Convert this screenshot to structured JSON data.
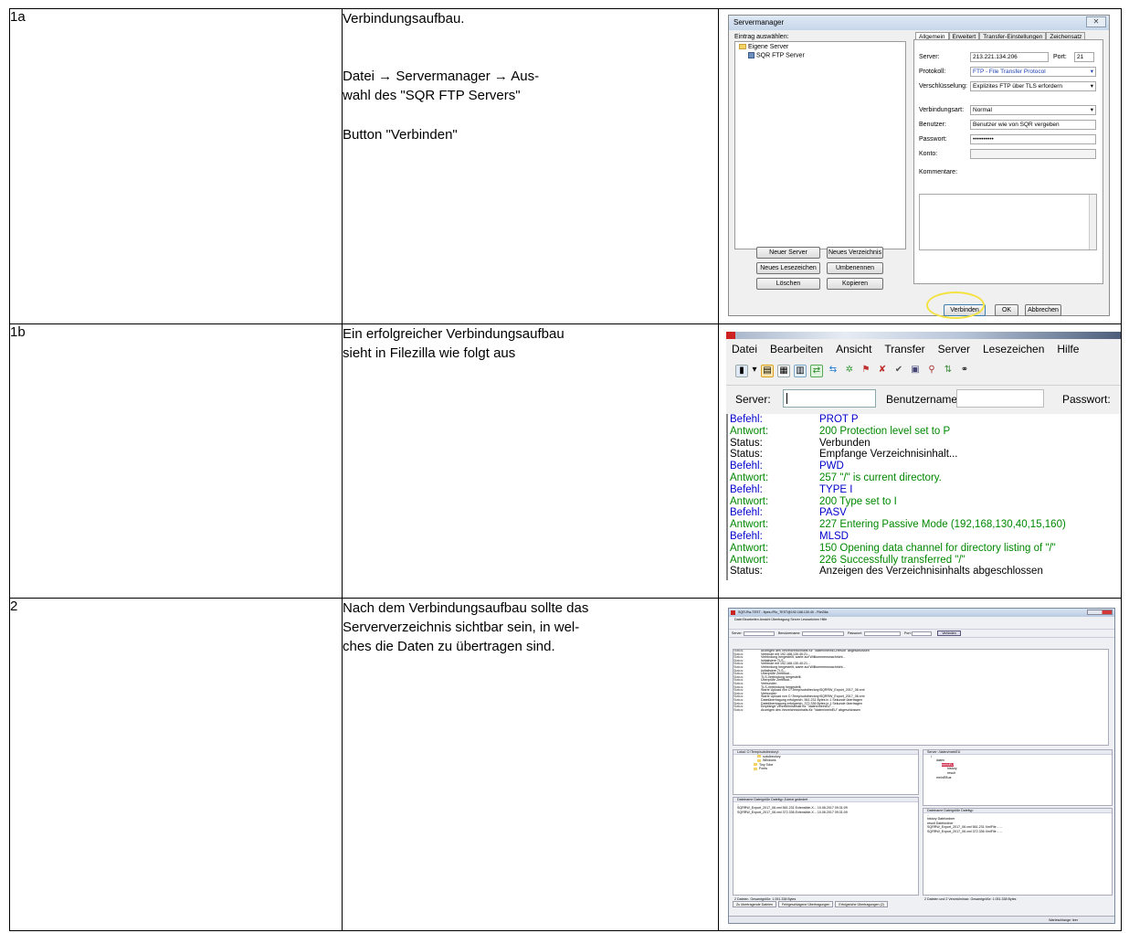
{
  "rows": [
    {
      "step": "1a",
      "lines": [
        "Verbindungsaufbau.",
        "Datei → Servermanager → Aus-",
        "wahl des \"SQR FTP Servers\"",
        "Button \"Verbinden\""
      ]
    },
    {
      "step": "1b",
      "lines": [
        "Ein erfolgreicher Verbindungsaufbau",
        "sieht in Filezilla wie folgt aus"
      ]
    },
    {
      "step": "2",
      "lines": [
        "Nach dem Verbindungsaufbau sollte das",
        "Serververzeichnis sichtbar sein, in wel-",
        "ches die Daten zu übertragen sind."
      ]
    }
  ],
  "servermanager": {
    "title": "Servermanager",
    "close": "✕",
    "eintrag_label": "Eintrag auswählen:",
    "tree": [
      "Eigene Server",
      "SQR FTP Server"
    ],
    "tabs": [
      "Allgemein",
      "Erweitert",
      "Transfer-Einstellungen",
      "Zeichensatz"
    ],
    "fields": [
      {
        "label": "Server:",
        "value": "213.221.134.206"
      },
      {
        "label": "Protokoll:",
        "value": "FTP - File Transfer Protocol"
      },
      {
        "label": "Verschlüsselung:",
        "value": "Explizites FTP über TLS erfordern"
      },
      {
        "label": "Verbindungsart:",
        "value": "Normal"
      },
      {
        "label": "Benutzer:",
        "value": "Benutzer wie von SQR vergeben"
      },
      {
        "label": "Passwort:",
        "value": "••••••••••"
      },
      {
        "label": "Konto:",
        "value": ""
      }
    ],
    "port_label": "Port:",
    "port_value": "21",
    "kommentare_label": "Kommentare:",
    "buttons": [
      "Neuer Server",
      "Neues Verzeichnis",
      "Neues Lesezeichen",
      "Umbenennen",
      "Löschen",
      "Kopieren"
    ],
    "footer_buttons": [
      "Verbinden",
      "OK",
      "Abbrechen"
    ]
  },
  "filezilla": {
    "menu": [
      "Datei",
      "Bearbeiten",
      "Ansicht",
      "Transfer",
      "Server",
      "Lesezeichen",
      "Hilfe"
    ],
    "server_label": "Server:",
    "user_label": "Benutzername:",
    "pass_label": "Passwort:",
    "log": [
      {
        "k": "Befehl:",
        "v": "PROT P",
        "t": "cmd"
      },
      {
        "k": "Antwort:",
        "v": "200 Protection level set to P",
        "t": "rsp"
      },
      {
        "k": "Status:",
        "v": "Verbunden",
        "t": "sts"
      },
      {
        "k": "Status:",
        "v": "Empfange Verzeichnisinhalt...",
        "t": "sts"
      },
      {
        "k": "Befehl:",
        "v": "PWD",
        "t": "cmd"
      },
      {
        "k": "Antwort:",
        "v": "257 \"/\" is current directory.",
        "t": "rsp"
      },
      {
        "k": "Befehl:",
        "v": "TYPE I",
        "t": "cmd"
      },
      {
        "k": "Antwort:",
        "v": "200 Type set to I",
        "t": "rsp"
      },
      {
        "k": "Befehl:",
        "v": "PASV",
        "t": "cmd"
      },
      {
        "k": "Antwort:",
        "v": "227 Entering Passive Mode (192,168,130,40,15,160)",
        "t": "rsp"
      },
      {
        "k": "Befehl:",
        "v": "MLSD",
        "t": "cmd"
      },
      {
        "k": "Antwort:",
        "v": "150 Opening data channel for directory listing of \"/\"",
        "t": "rsp"
      },
      {
        "k": "Antwort:",
        "v": "226 Successfully transferred \"/\"",
        "t": "rsp"
      },
      {
        "k": "Status:",
        "v": "Anzeigen des Verzeichnisinhalts abgeschlossen",
        "t": "sts"
      }
    ]
  },
  "fz_window": {
    "title": "SQR-Rw-TEST - ftpes://Ro_TEST@192.168.130.40 - FileZilla",
    "menu": "Datei  Bearbeiten  Ansicht  Übertragung  Server  Lesezeichen  Hilfe",
    "server_label": "Server:",
    "user_label": "Benutzername:",
    "pass_label": "Passwort:",
    "port_label": "Port:",
    "connect": "Verbinden",
    "log": [
      "Anzeigen des Verzeichnisinhalts für \"/daten/meinEU/result\" abgeschlossen",
      "Verbinde mit 192.168.130.40:21...",
      "Verbindung hergestellt, warte auf Willkommensnachricht...",
      "Initialisiere TLS...",
      "Verbinde mit 192.168.130.40:21...",
      "Verbindung hergestellt, warte auf Willkommensnachricht...",
      "Initialisiere TLS...",
      "Überprüfe Zertifikat...",
      "TLS-Verbindung hergestellt.",
      "Überprüfe Zertifikat...",
      "Verbunden",
      "TLS-Verbindung hergestellt.",
      "Starte Upload von C:\\Temp\\subdirectory\\SQRRW_Export_2017_06.xml",
      "Verbunden",
      "Starte Upload von C:\\Temp\\subdirectory\\SQRRW_Export_2017_06.xml",
      "Dateiübertragung erfolgreich, 561.231 Bytes in 1 Sekunde übertragen",
      "Dateiübertragung erfolgreich, 372.336 Bytes in 1 Sekunde übertragen",
      "Empfange Verzeichnisinhalt für \"/daten/meinEU\"...",
      "Anzeigen des Verzeichnisinhalts für \"/daten/meinEU\" abgeschlossen"
    ],
    "local_label": "Lokal:",
    "local_path": "C:\\Temp\\subdirectory\\",
    "local_tree": [
      "subdirectory",
      "Windows",
      "Tiny Tobe",
      "Fonts"
    ],
    "local_cols": "Dateiname                      Dateigröße  Dateityp           Zuletzt geändert",
    "local_files": [
      "SQRRW_Export_2017_06.xml     561.231  Extensible-X...   10.06.2017 09:31:09",
      "SQRRW_Export_2017_06.xml     372.336  Extensible-X...   10.06.2017 09:31:09"
    ],
    "local_status": "2 Dateien. Gesamtgröße: 1.051.338 Bytes",
    "remote_label": "Server:",
    "remote_path": "/daten/meinEU",
    "remote_tree": [
      "/",
      "daten",
      "meinEU",
      "history",
      "result",
      "meinEBus"
    ],
    "remote_cols": "Dateiname                                               Dateigröße  Dateityp",
    "remote_files": [
      "..",
      "history                                                            Dateiordner",
      "result                                                              Dateiordner",
      "SQRRW_Export_2017_06.xml                      561.231  XmlFile - ...",
      "SQRRW_Export_2017_06.xml                      372.336  XmlFile - ..."
    ],
    "remote_status": "2 Dateien und 2 Verzeichnisse. Gesamtgröße: 1.051.338 Bytes",
    "queue_cols": "Server/Lokale Datei          Richtung   Datei auf Server                 Größe   Priorität   Status",
    "queue_tabs": [
      "Zu übertragende Dateien",
      "Fehlgeschlagene Übertragungen",
      "Erfolgreiche Übertragungen (2)"
    ],
    "queue_status": "Warteschlange: leer"
  }
}
